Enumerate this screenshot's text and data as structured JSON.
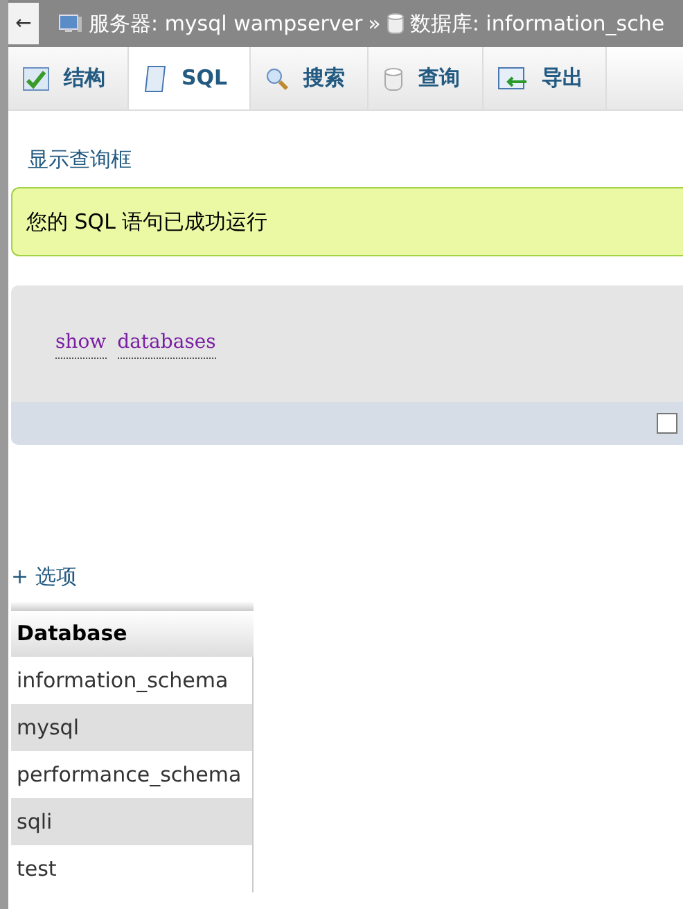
{
  "breadcrumb": [
    {
      "kind": "server",
      "text": "服务器: mysql wampserver"
    },
    {
      "kind": "database",
      "text": "数据库: information_sche"
    }
  ],
  "breadcrumb_separator": "»",
  "back_button": "←",
  "tabs": [
    {
      "kind": "structure",
      "label": "结构",
      "selected": false
    },
    {
      "kind": "sql",
      "label": "SQL",
      "selected": true
    },
    {
      "kind": "search",
      "label": "搜索",
      "selected": false
    },
    {
      "kind": "query",
      "label": "查询",
      "selected": false
    },
    {
      "kind": "export",
      "label": "导出",
      "selected": false
    }
  ],
  "show_query_link": "显示查询框",
  "success_message": "您的 SQL 语句已成功运行",
  "sql_words": [
    "show",
    "databases"
  ],
  "profiling_checkbox": {
    "checked": false
  },
  "options_link": "+ 选项",
  "table": {
    "columns": [
      "Database"
    ],
    "rows": [
      [
        "information_schema"
      ],
      [
        "mysql"
      ],
      [
        "performance_schema"
      ],
      [
        "sqli"
      ],
      [
        "test"
      ]
    ]
  }
}
